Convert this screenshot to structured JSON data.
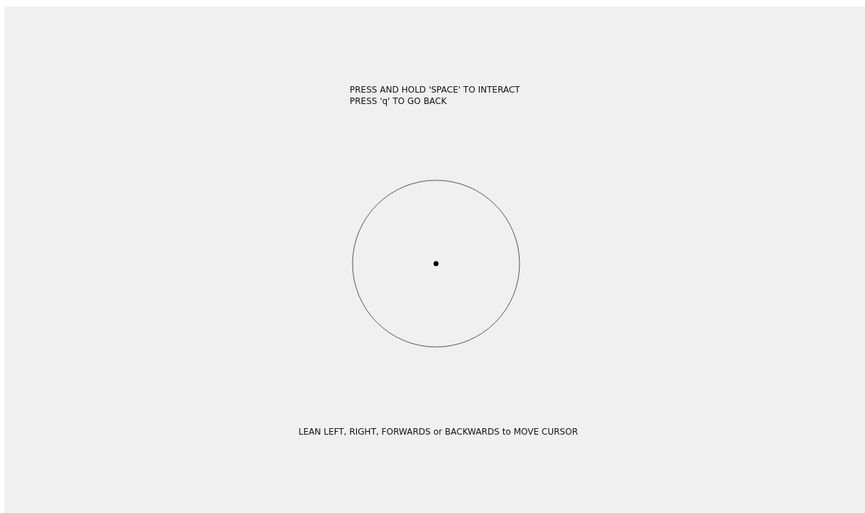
{
  "instructions": [
    "PRESS AND HOLD 'SPACE' TO INTERACT",
    "PRESS 'q' TO GO BACK"
  ],
  "hint": "LEAN LEFT, RIGHT, FORWARDS or BACKWARDS to MOVE CURSOR"
}
